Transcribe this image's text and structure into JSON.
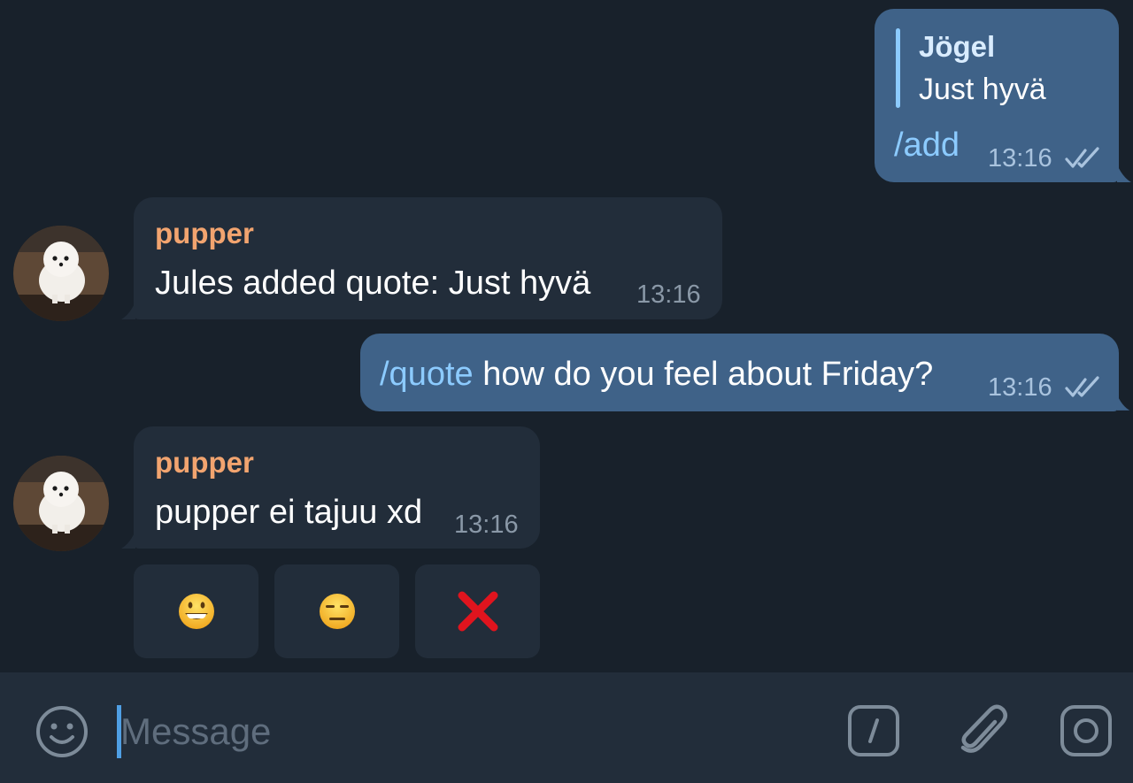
{
  "messages": [
    {
      "direction": "outgoing",
      "reply": {
        "author": "Jögel",
        "text": "Just hyvä"
      },
      "command": "/add",
      "text": "",
      "time": "13:16",
      "status": "read"
    },
    {
      "direction": "incoming",
      "sender": "pupper",
      "text": "Jules added quote: Just hyvä",
      "time": "13:16"
    },
    {
      "direction": "outgoing",
      "command": "/quote",
      "text": " how do you feel about Friday?",
      "time": "13:16",
      "status": "read"
    },
    {
      "direction": "incoming",
      "sender": "pupper",
      "text": "pupper ei tajuu xd",
      "time": "13:16"
    }
  ],
  "inline_keyboard": [
    {
      "icon": "grinning-face-emoji"
    },
    {
      "icon": "expressionless-face-emoji"
    },
    {
      "icon": "cross-mark-emoji"
    }
  ],
  "composer": {
    "placeholder": "Message",
    "icons": [
      "smiley-icon",
      "bot-command-icon",
      "paperclip-icon",
      "camera-icon"
    ]
  },
  "colors": {
    "background": "#18212b",
    "outgoing_bubble": "#3f6288",
    "incoming_bubble": "#222d3a",
    "sender_name": "#f2a46f",
    "link": "#8ccbff"
  }
}
